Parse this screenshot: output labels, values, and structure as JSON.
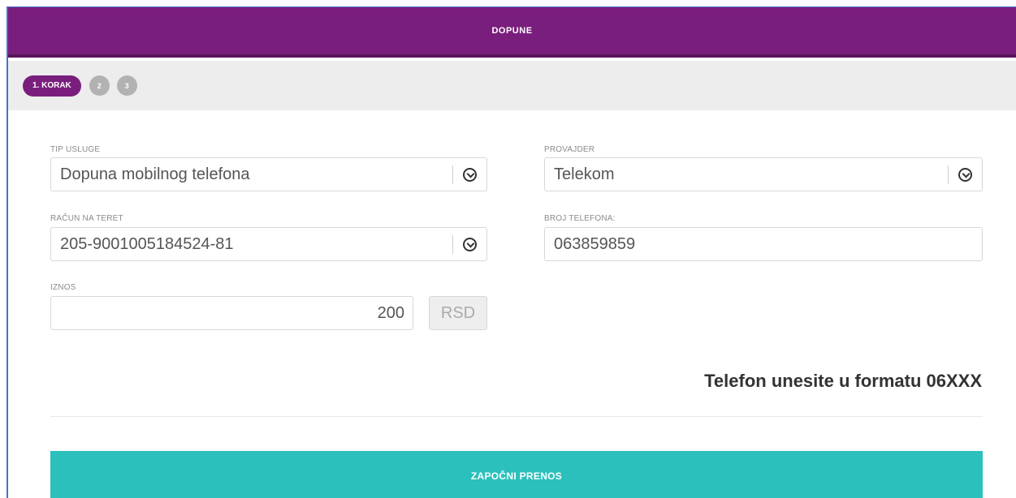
{
  "header": {
    "title": "DOPUNE"
  },
  "steps": {
    "active": "1. KORAK",
    "step2": "2",
    "step3": "3"
  },
  "form": {
    "service_type": {
      "label": "TIP USLUGE",
      "value": "Dopuna mobilnog telefona"
    },
    "provider": {
      "label": "PROVAJDER",
      "value": "Telekom"
    },
    "account": {
      "label": "RAČUN NA TERET",
      "value": "205-9001005184524-81"
    },
    "phone": {
      "label": "BROJ TELEFONA:",
      "value": "063859859"
    },
    "amount": {
      "label": "IZNOS",
      "value": "200",
      "currency": "RSD"
    }
  },
  "hint": "Telefon unesite u formatu 06XXX",
  "submit_label": "ZAPOČNI PRENOS",
  "colors": {
    "primary": "#7a1e7d",
    "accent": "#2bc0bb",
    "step_inactive": "#b2b2b2"
  },
  "icons": {
    "dropdown": "chevron-down-circle-icon"
  }
}
